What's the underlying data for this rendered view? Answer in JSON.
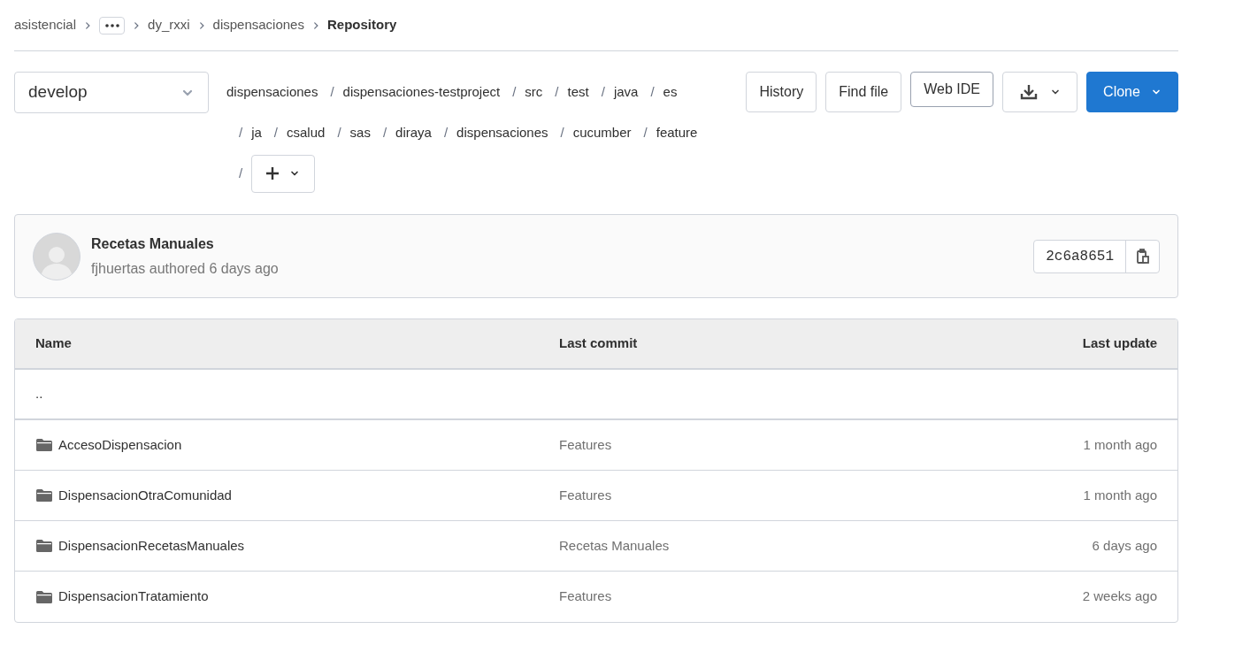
{
  "breadcrumbs": [
    {
      "kind": "link",
      "label": "asistencial"
    },
    {
      "kind": "ellipsis"
    },
    {
      "kind": "link",
      "label": "dy_rxxi"
    },
    {
      "kind": "link",
      "label": "dispensaciones"
    },
    {
      "kind": "current",
      "label": "Repository"
    }
  ],
  "branch": {
    "value": "develop"
  },
  "path": {
    "separator": "/",
    "segments": [
      "dispensaciones",
      "dispensaciones-testproject",
      "src",
      "test",
      "java",
      "es",
      "ja",
      "csalud",
      "sas",
      "diraya",
      "dispensaciones",
      "cucumber",
      "feature"
    ]
  },
  "actions": [
    {
      "kind": "default",
      "label": "History"
    },
    {
      "kind": "default",
      "label": "Find file"
    },
    {
      "kind": "outlined",
      "label": "Web IDE"
    },
    {
      "kind": "download"
    },
    {
      "kind": "primary",
      "label": "Clone"
    }
  ],
  "commit": {
    "title": "Recetas Manuales",
    "meta": "fjhuertas authored 6 days ago",
    "sha": "2c6a8651"
  },
  "table": {
    "columns": [
      "Name",
      "Last commit",
      "Last update"
    ],
    "parent": "..",
    "rows": [
      {
        "name": "AccesoDispensacion",
        "last_commit": "Features",
        "last_update": "1 month ago"
      },
      {
        "name": "DispensacionOtraComunidad",
        "last_commit": "Features",
        "last_update": "1 month ago"
      },
      {
        "name": "DispensacionRecetasManuales",
        "last_commit": "Recetas Manuales",
        "last_update": "6 days ago"
      },
      {
        "name": "DispensacionTratamiento",
        "last_commit": "Features",
        "last_update": "2 weeks ago"
      }
    ]
  }
}
